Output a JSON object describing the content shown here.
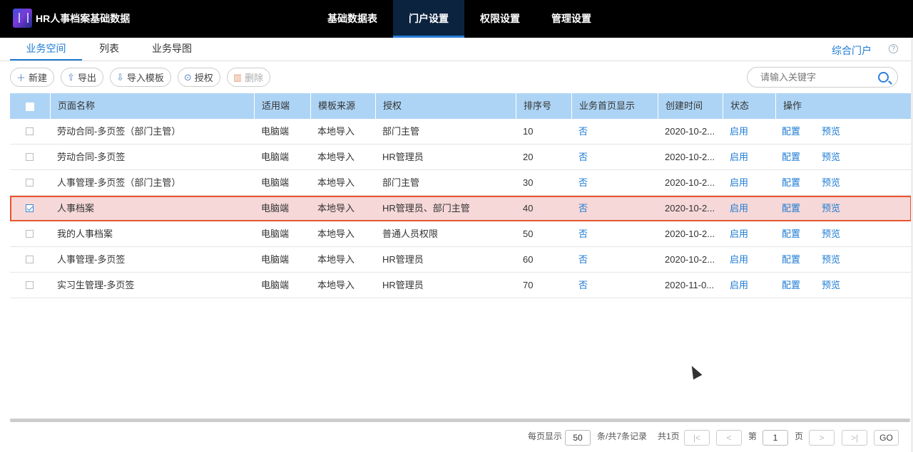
{
  "app": {
    "title": "HR人事档案基础数据"
  },
  "topnav": [
    {
      "label": "基础数据表",
      "active": false
    },
    {
      "label": "门户设置",
      "active": true
    },
    {
      "label": "权限设置",
      "active": false
    },
    {
      "label": "管理设置",
      "active": false
    }
  ],
  "tabs": [
    {
      "label": "业务空间",
      "active": true
    },
    {
      "label": "列表",
      "active": false
    },
    {
      "label": "业务导图",
      "active": false
    }
  ],
  "portal_link": "综合门户",
  "help_icon": "?",
  "toolbar": {
    "new": "新建",
    "export": "导出",
    "import_template": "导入模板",
    "authorize": "授权",
    "delete": "删除"
  },
  "search": {
    "placeholder": "请输入关键字"
  },
  "table": {
    "columns": [
      "页面名称",
      "适用端",
      "模板来源",
      "授权",
      "排序号",
      "业务首页显示",
      "创建时间",
      "状态",
      "操作"
    ],
    "rows": [
      {
        "name": "劳动合同-多页签（部门主管）",
        "term": "电脑端",
        "source": "本地导入",
        "auth": "部门主管",
        "order": "10",
        "home": "否",
        "time": "2020-10-2...",
        "status": "启用",
        "op1": "配置",
        "op2": "预览",
        "checked": false
      },
      {
        "name": "劳动合同-多页签",
        "term": "电脑端",
        "source": "本地导入",
        "auth": "HR管理员",
        "order": "20",
        "home": "否",
        "time": "2020-10-2...",
        "status": "启用",
        "op1": "配置",
        "op2": "预览",
        "checked": false
      },
      {
        "name": "人事管理-多页签（部门主管）",
        "term": "电脑端",
        "source": "本地导入",
        "auth": "部门主管",
        "order": "30",
        "home": "否",
        "time": "2020-10-2...",
        "status": "启用",
        "op1": "配置",
        "op2": "预览",
        "checked": false
      },
      {
        "name": "人事档案",
        "term": "电脑端",
        "source": "本地导入",
        "auth": "HR管理员、部门主管",
        "order": "40",
        "home": "否",
        "time": "2020-10-2...",
        "status": "启用",
        "op1": "配置",
        "op2": "预览",
        "checked": true
      },
      {
        "name": "我的人事档案",
        "term": "电脑端",
        "source": "本地导入",
        "auth": "普通人员权限",
        "order": "50",
        "home": "否",
        "time": "2020-10-2...",
        "status": "启用",
        "op1": "配置",
        "op2": "预览",
        "checked": false
      },
      {
        "name": "人事管理-多页签",
        "term": "电脑端",
        "source": "本地导入",
        "auth": "HR管理员",
        "order": "60",
        "home": "否",
        "time": "2020-10-2...",
        "status": "启用",
        "op1": "配置",
        "op2": "预览",
        "checked": false
      },
      {
        "name": "实习生管理-多页签",
        "term": "电脑端",
        "source": "本地导入",
        "auth": "HR管理员",
        "order": "70",
        "home": "否",
        "time": "2020-11-0...",
        "status": "启用",
        "op1": "配置",
        "op2": "预览",
        "checked": false
      }
    ]
  },
  "pager": {
    "per_page_label": "每页显示",
    "per_page": "50",
    "total_label": "条/共7条记录",
    "pages_label": "共1页",
    "page_prefix": "第",
    "page": "1",
    "page_suffix": "页",
    "go": "GO",
    "first": "|<",
    "prev": "<",
    "next": ">",
    "last": ">|"
  },
  "colors": {
    "accent": "#1d7bd4",
    "header_bg": "#add4f5",
    "selected_row": "#f6d8d8",
    "selected_border": "#e8552b"
  }
}
